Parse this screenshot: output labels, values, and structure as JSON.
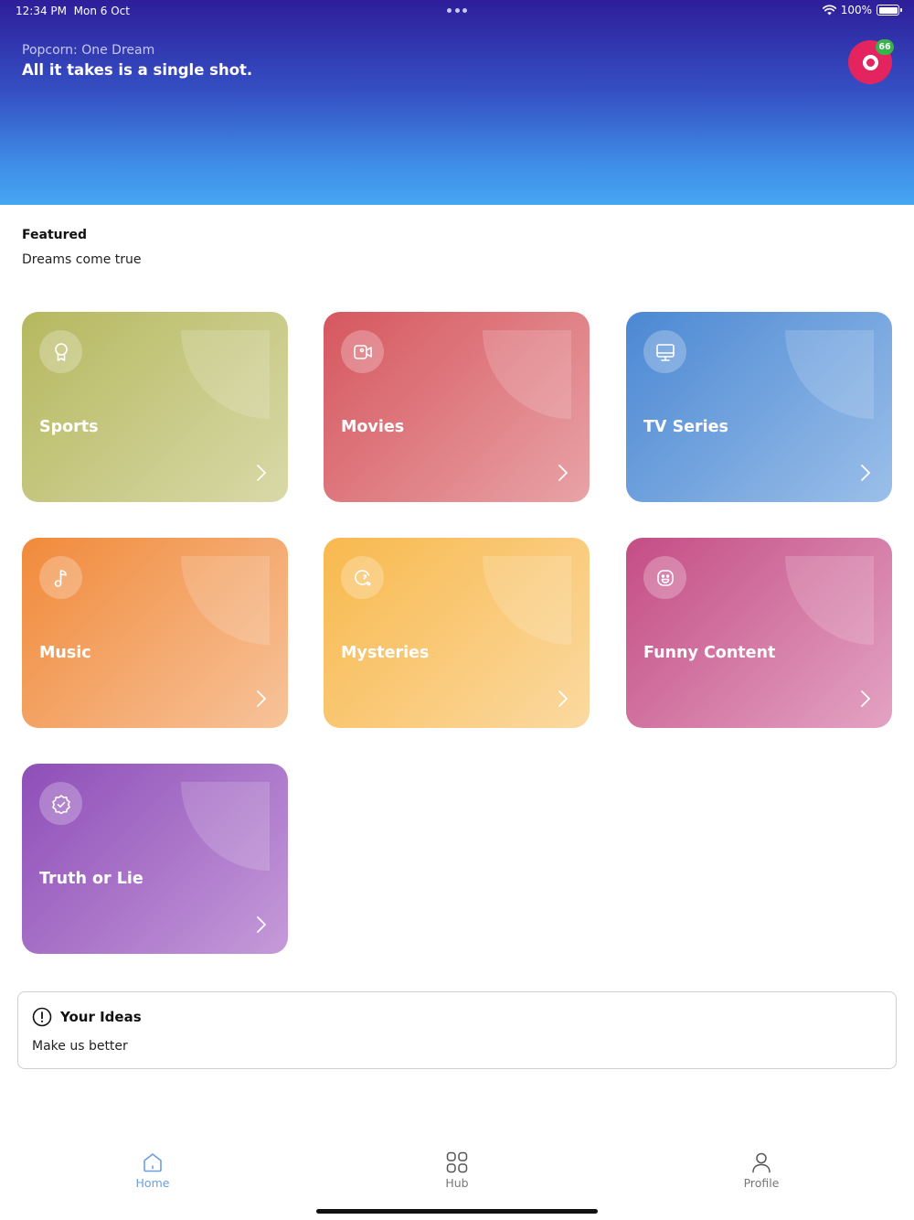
{
  "status_bar": {
    "time": "12:34 PM",
    "date": "Mon 6 Oct",
    "battery": "100%",
    "battery_level": 1.0
  },
  "header": {
    "subtitle": "Popcorn: One Dream",
    "tagline": "All it takes is a single shot.",
    "avatar_initial_icon": "ring-icon",
    "notification_count": "66",
    "colors": {
      "gradient_top": "#2e1e9a",
      "gradient_bottom": "#45a6f3",
      "avatar": "#e3245e",
      "badge": "#36b44a"
    }
  },
  "featured": {
    "title": "Featured",
    "subtitle": "Dreams come true"
  },
  "categories": [
    {
      "label": "Sports",
      "icon": "award-icon",
      "color_from": "#b6b85f",
      "color_to": "#d8d9a8"
    },
    {
      "label": "Movies",
      "icon": "video-camera-icon",
      "color_from": "#d6575f",
      "color_to": "#e8a3a6"
    },
    {
      "label": "TV Series",
      "icon": "monitor-icon",
      "color_from": "#4b88d3",
      "color_to": "#9bbfe9"
    },
    {
      "label": "Music",
      "icon": "music-note-icon",
      "color_from": "#f18a3b",
      "color_to": "#f7c39a"
    },
    {
      "label": "Mysteries",
      "icon": "mystery-icon",
      "color_from": "#f8b94e",
      "color_to": "#fbd9a0"
    },
    {
      "label": "Funny Content",
      "icon": "smile-icon",
      "color_from": "#c44d85",
      "color_to": "#e3a3c3"
    },
    {
      "label": "Truth or Lie",
      "icon": "verified-badge-icon",
      "color_from": "#8e4eb8",
      "color_to": "#c59ad9"
    }
  ],
  "ideas": {
    "title": "Your Ideas",
    "subtitle": "Make us better"
  },
  "tabs": [
    {
      "label": "Home",
      "icon": "home-icon",
      "active": true
    },
    {
      "label": "Hub",
      "icon": "grid-icon",
      "active": false
    },
    {
      "label": "Profile",
      "icon": "user-icon",
      "active": false
    }
  ]
}
